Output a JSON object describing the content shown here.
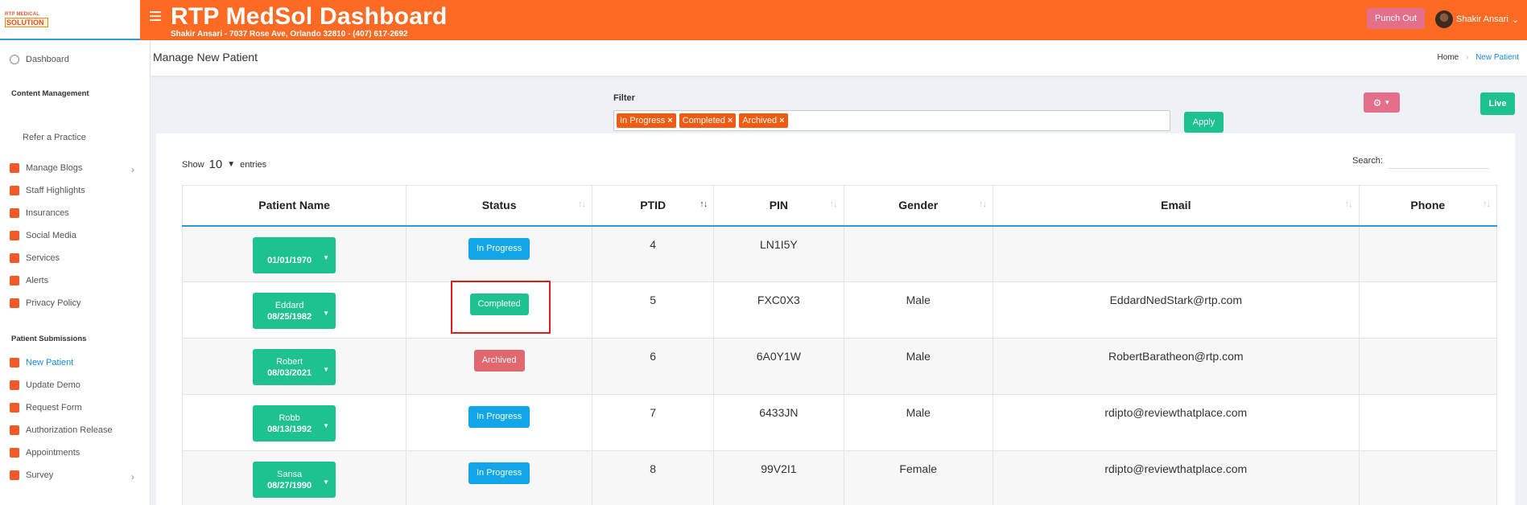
{
  "header": {
    "logo_line1": "RTP MEDICAL",
    "logo_line2": "SOLUTION",
    "title": "RTP MedSol Dashboard",
    "subtitle": "Shakir Ansari - 7037 Rose Ave, Orlando 32810 - (407) 617-2692",
    "punch_out": "Punch Out",
    "user_name": "Shakir Ansari"
  },
  "sidebar": {
    "dashboard": "Dashboard",
    "content_heading": "Content Management",
    "refer": "Refer a Practice",
    "items": [
      "Manage Blogs",
      "Staff Highlights",
      "Insurances",
      "Social Media",
      "Services",
      "Alerts",
      "Privacy Policy"
    ],
    "submissions_heading": "Patient Submissions",
    "sub_items": [
      "New Patient",
      "Update Demo",
      "Request Form",
      "Authorization Release",
      "Appointments",
      "Survey"
    ]
  },
  "page": {
    "title": "Manage New Patient",
    "crumb_home": "Home",
    "crumb_current": "New Patient"
  },
  "filter": {
    "label": "Filter",
    "tags": [
      "In Progress",
      "Completed",
      "Archived"
    ],
    "apply": "Apply",
    "live": "Live"
  },
  "table_controls": {
    "show": "Show",
    "entries_value": "10",
    "entries": "entries",
    "search": "Search:"
  },
  "table": {
    "columns": [
      "Patient Name",
      "Status",
      "PTID",
      "PIN",
      "Gender",
      "Email",
      "Phone"
    ],
    "rows": [
      {
        "name": "",
        "dob": "01/01/1970",
        "status": "In Progress",
        "ptid": "4",
        "pin": "LN1I5Y",
        "gender": "",
        "email": "",
        "phone": ""
      },
      {
        "name": "Eddard",
        "dob": "08/25/1982",
        "status": "Completed",
        "ptid": "5",
        "pin": "FXC0X3",
        "gender": "Male",
        "email": "EddardNedStark@rtp.com",
        "phone": ""
      },
      {
        "name": "Robert",
        "dob": "08/03/2021",
        "status": "Archived",
        "ptid": "6",
        "pin": "6A0Y1W",
        "gender": "Male",
        "email": "RobertBaratheon@rtp.com",
        "phone": ""
      },
      {
        "name": "Robb",
        "dob": "08/13/1992",
        "status": "In Progress",
        "ptid": "7",
        "pin": "6433JN",
        "gender": "Male",
        "email": "rdipto@reviewthatplace.com",
        "phone": ""
      },
      {
        "name": "Sansa",
        "dob": "08/27/1990",
        "status": "In Progress",
        "ptid": "8",
        "pin": "99V2I1",
        "gender": "Female",
        "email": "rdipto@reviewthatplace.com",
        "phone": ""
      }
    ]
  }
}
